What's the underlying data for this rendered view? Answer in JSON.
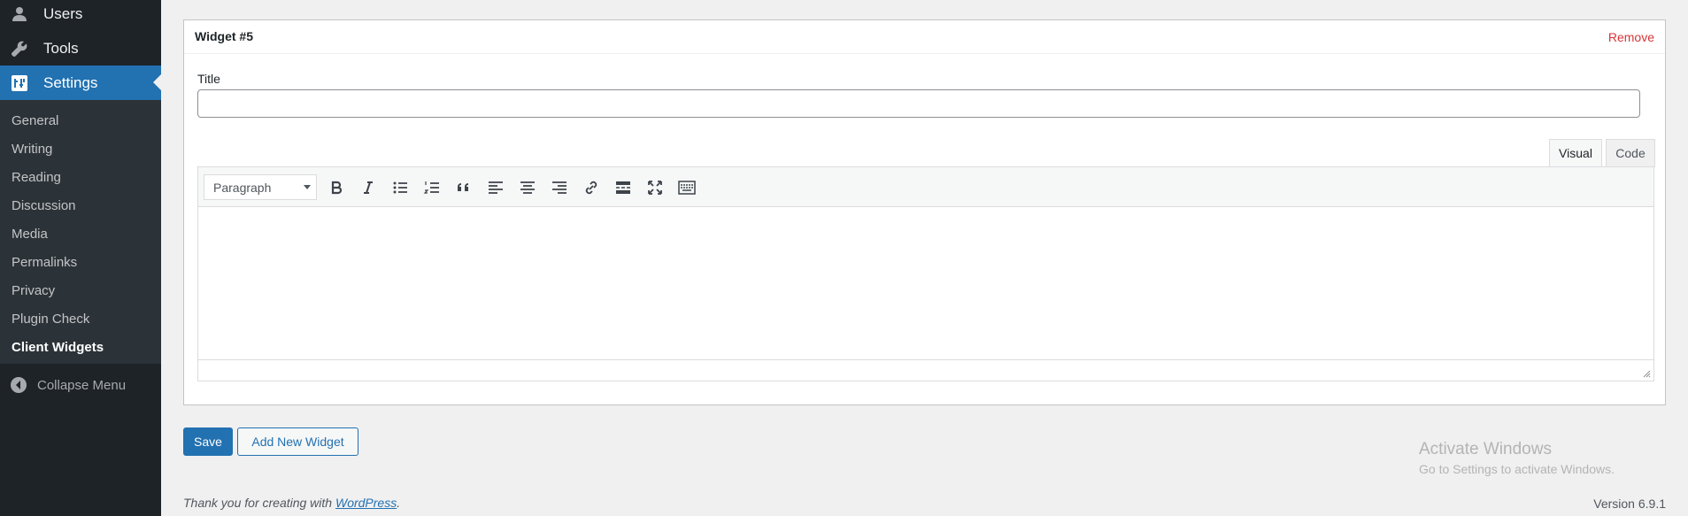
{
  "sidebar": {
    "top_items": [
      {
        "label": "Users",
        "icon": "users-icon"
      },
      {
        "label": "Tools",
        "icon": "wrench-icon"
      },
      {
        "label": "Settings",
        "icon": "settings-icon",
        "current": true
      }
    ],
    "submenu": [
      "General",
      "Writing",
      "Reading",
      "Discussion",
      "Media",
      "Permalinks",
      "Privacy",
      "Plugin Check",
      "Client Widgets"
    ],
    "submenu_current": "Client Widgets",
    "collapse_label": "Collapse Menu"
  },
  "widget": {
    "title": "Widget #5",
    "remove_label": "Remove",
    "title_field_label": "Title",
    "title_value": "",
    "editor": {
      "tabs": {
        "visual": "Visual",
        "code": "Code"
      },
      "active_tab": "Visual",
      "format_select": "Paragraph",
      "toolbar_buttons": [
        "bold",
        "italic",
        "bulleted-list",
        "numbered-list",
        "blockquote",
        "align-left",
        "align-center",
        "align-right",
        "link",
        "read-more",
        "fullscreen",
        "toolbar-toggle"
      ]
    }
  },
  "actions": {
    "save_label": "Save",
    "add_label": "Add New Widget"
  },
  "overlay": {
    "activate_title": "Activate Windows",
    "activate_sub": "Go to Settings to activate Windows."
  },
  "footer": {
    "thanks_prefix": "Thank you for creating with ",
    "thanks_link": "WordPress",
    "thanks_suffix": ".",
    "version": "Version 6.9.1"
  },
  "colors": {
    "sidebar_bg": "#1d2327",
    "submenu_bg": "#2c3338",
    "accent": "#2271b1",
    "remove": "#d63638"
  }
}
